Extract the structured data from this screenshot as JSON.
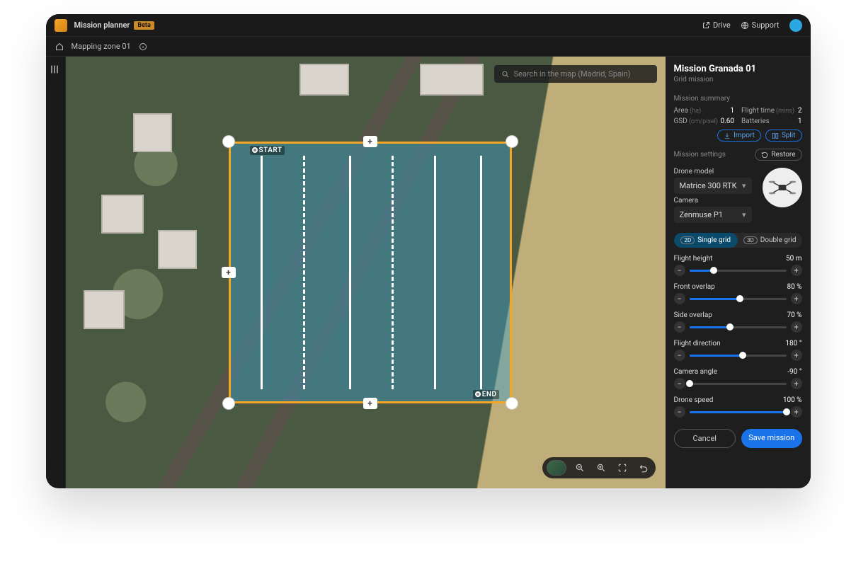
{
  "topbar": {
    "app_title": "Mission planner",
    "badge": "Beta",
    "drive": "Drive",
    "support": "Support"
  },
  "subbar": {
    "breadcrumb": "Mapping zone 01"
  },
  "search": {
    "placeholder": "Search in the map (Madrid, Spain)"
  },
  "overlay": {
    "start_label": "START",
    "end_label": "END"
  },
  "panel": {
    "title": "Mission Granada 01",
    "subtitle": "Grid mission",
    "summary_header": "Mission summary",
    "summary": {
      "area_label": "Area",
      "area_unit": "(ha)",
      "area_value": "1",
      "flight_time_label": "Flight time",
      "flight_time_unit": "(mins)",
      "flight_time_value": "2",
      "gsd_label": "GSD",
      "gsd_unit": "(cm/pixel)",
      "gsd_value": "0.60",
      "batteries_label": "Batteries",
      "batteries_value": "1"
    },
    "import_label": "Import",
    "split_label": "Split",
    "settings_header": "Mission settings",
    "restore_label": "Restore",
    "drone_model_label": "Drone model",
    "drone_model_value": "Matrice 300 RTK",
    "camera_label": "Camera",
    "camera_value": "Zenmuse P1",
    "grid_2d_badge": "2D",
    "grid_2d_label": "Single grid",
    "grid_3d_badge": "3D",
    "grid_3d_label": "Double grid",
    "sliders": {
      "flight_height": {
        "label": "Flight height",
        "value": "50 m",
        "pct": 25
      },
      "front_overlap": {
        "label": "Front overlap",
        "value": "80 %",
        "pct": 52
      },
      "side_overlap": {
        "label": "Side overlap",
        "value": "70 %",
        "pct": 42
      },
      "flight_direction": {
        "label": "Flight direction",
        "value": "180 °",
        "pct": 55
      },
      "camera_angle": {
        "label": "Camera angle",
        "value": "-90 °",
        "pct": 0
      },
      "drone_speed": {
        "label": "Drone speed",
        "value": "100 %",
        "pct": 100
      }
    },
    "cancel_label": "Cancel",
    "save_label": "Save mission"
  }
}
